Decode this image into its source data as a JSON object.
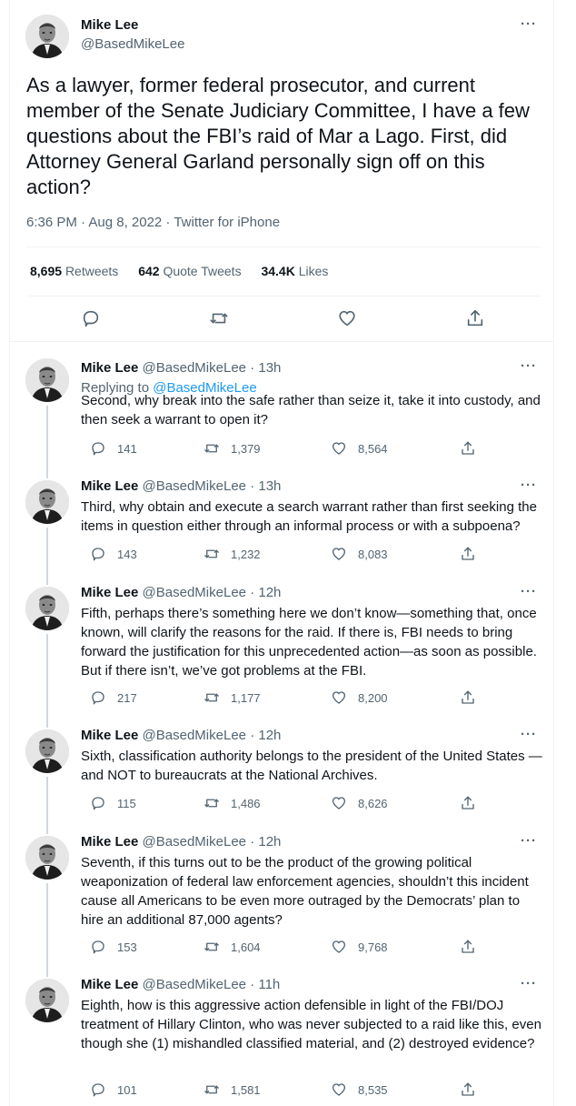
{
  "main": {
    "name": "Mike Lee",
    "handle": "@BasedMikeLee",
    "more": "···",
    "text": "As a lawyer, former federal prosecutor, and current member of the Senate Judiciary Committee, I have a few questions about the FBI’s raid of Mar a Lago. First, did Attorney General Garland personally sign off on this action?",
    "meta": "6:36 PM · Aug 8, 2022 · Twitter for iPhone",
    "retweets_count": "8,695",
    "retweets_label": "Retweets",
    "quotes_count": "642",
    "quotes_label": "Quote Tweets",
    "likes_count": "34.4K",
    "likes_label": "Likes"
  },
  "replies": [
    {
      "name": "Mike Lee",
      "handle": "@BasedMikeLee",
      "time": "· 13h",
      "replying_prefix": "Replying to ",
      "replying_to": "@BasedMikeLee",
      "text": "Second, why break into the safe rather than seize it, take it into custody, and then seek a warrant to open it?",
      "replies": "141",
      "retweets": "1,379",
      "likes": "8,564"
    },
    {
      "name": "Mike Lee",
      "handle": "@BasedMikeLee",
      "time": "· 13h",
      "text": "Third, why obtain and execute a search warrant rather than first seeking the items in question either through an informal process or with a subpoena?",
      "replies": "143",
      "retweets": "1,232",
      "likes": "8,083"
    },
    {
      "name": "Mike Lee",
      "handle": "@BasedMikeLee",
      "time": "· 12h",
      "text": "Fifth, perhaps there’s something here we don’t know—something that, once known, will clarify the reasons for the raid.  If there is, FBI needs to bring forward the justification for this unprecedented action—as soon as possible.  But if there isn’t, we’ve got problems at the FBI.",
      "replies": "217",
      "retweets": "1,177",
      "likes": "8,200"
    },
    {
      "name": "Mike Lee",
      "handle": "@BasedMikeLee",
      "time": "· 12h",
      "text": "Sixth, classification authority belongs to the president of the United States — and NOT to bureaucrats at the National Archives.",
      "replies": "115",
      "retweets": "1,486",
      "likes": "8,626"
    },
    {
      "name": "Mike Lee",
      "handle": "@BasedMikeLee",
      "time": "· 12h",
      "text": "Seventh, if this turns out to be the product of the growing political weaponization of federal law enforcement agencies, shouldn’t this incident cause all Americans to be even more outraged by the Democrats’ plan to hire an additional 87,000 agents?",
      "replies": "153",
      "retweets": "1,604",
      "likes": "9,768"
    },
    {
      "name": "Mike Lee",
      "handle": "@BasedMikeLee",
      "time": "· 11h",
      "text": "Eighth, how is this aggressive action defensible in light of the FBI/DOJ treatment of Hillary Clinton, who was never subjected to a raid like this, even though she (1) mishandled classified material, and (2) destroyed evidence?",
      "replies": "101",
      "retweets": "1,581",
      "likes": "8,535"
    }
  ],
  "icons": [
    "more-icon",
    "reply-icon",
    "retweet-icon",
    "like-icon",
    "share-icon"
  ],
  "colors": {
    "accent": "#1d9bf0",
    "text": "#0f1419",
    "muted": "#536471",
    "border": "#eff3f4"
  }
}
